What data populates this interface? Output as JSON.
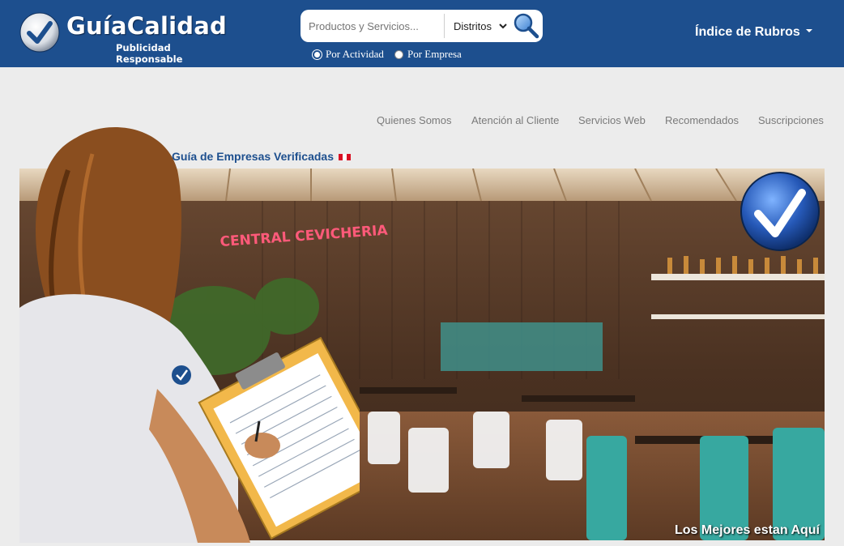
{
  "brand": {
    "title": "GuíaCalidad",
    "subtitle": "Publicidad Responsable"
  },
  "search": {
    "placeholder": "Productos y Servicios...",
    "district_selected": "Distritos",
    "search_icon": "magnifier-icon",
    "options": [
      {
        "label": "Por Actividad",
        "checked": true
      },
      {
        "label": "Por Empresa",
        "checked": false
      }
    ]
  },
  "header": {
    "index_label": "Índice de Rubros",
    "bg_color": "#1d4f8e"
  },
  "nav": {
    "items": [
      "Quienes Somos",
      "Atención al Cliente",
      "Servicios Web",
      "Recomendados",
      "Suscripciones"
    ]
  },
  "guide": {
    "label": "Guía de Empresas Verificadas",
    "flag": "peru-flag-icon"
  },
  "banner": {
    "sign_text": "CENTRAL CEVICHERIA",
    "caption": "Los Mejores estan Aquí",
    "badge_icon": "checkmark-badge-icon"
  }
}
